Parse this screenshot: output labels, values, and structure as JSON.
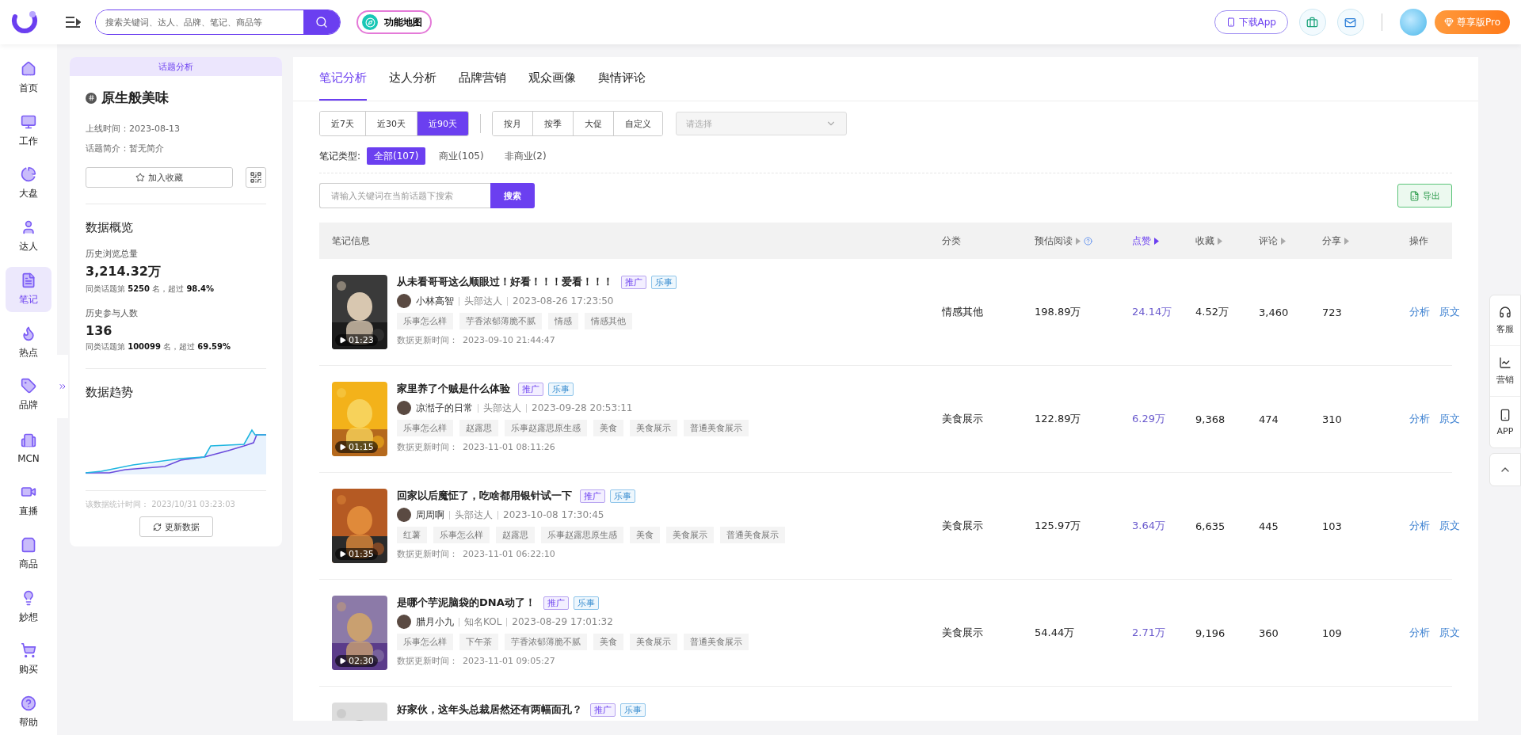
{
  "header": {
    "search_placeholder": "搜索关键词、达人、品牌、笔记、商品等",
    "feature_map": "功能地图",
    "download": "下载App",
    "vip": "尊享版Pro"
  },
  "nav": [
    {
      "label": "首页",
      "selected": false
    },
    {
      "label": "工作",
      "selected": false
    },
    {
      "label": "大盘",
      "selected": false
    },
    {
      "label": "达人",
      "selected": false
    },
    {
      "label": "笔记",
      "selected": true
    },
    {
      "label": "热点",
      "selected": false
    },
    {
      "label": "品牌",
      "selected": false
    },
    {
      "label": "MCN",
      "selected": false
    },
    {
      "label": "直播",
      "selected": false
    },
    {
      "label": "商品",
      "selected": false
    },
    {
      "label": "妙想",
      "selected": false
    },
    {
      "label": "购买",
      "selected": false
    },
    {
      "label": "帮助",
      "selected": false
    }
  ],
  "topic": {
    "banner": "话题分析",
    "title": "原生般美味",
    "online": "上线时间：2023-08-13",
    "intro": "话题简介：暂无简介",
    "favorite": "加入收藏",
    "overview_title": "数据概览",
    "metrics": [
      {
        "label": "历史浏览总量",
        "value": "3,214.32万",
        "rank": "同类话题第 **5250** 名，超过 **98.4%**"
      },
      {
        "label": "历史参与人数",
        "value": "136",
        "rank": "同类话题第 **100099** 名，超过 **69.59%**"
      }
    ],
    "trend_title": "数据趋势",
    "stat_time": "该数据统计时间：  2023/10/31 03:23:03",
    "refresh": "更新数据"
  },
  "tabs": [
    {
      "label": "笔记分析",
      "selected": true
    },
    {
      "label": "达人分析",
      "selected": false
    },
    {
      "label": "品牌营销",
      "selected": false
    },
    {
      "label": "观众画像",
      "selected": false
    },
    {
      "label": "舆情评论",
      "selected": false
    }
  ],
  "ranges": [
    {
      "label": "近7天",
      "selected": false
    },
    {
      "label": "近30天",
      "selected": false
    },
    {
      "label": "近90天",
      "selected": true
    }
  ],
  "periods": [
    "按月",
    "按季",
    "大促",
    "自定义"
  ],
  "period_select": {
    "placeholder": "请选择"
  },
  "note_types": {
    "label": "笔记类型:",
    "options": [
      {
        "label": "全部(107)",
        "selected": true
      },
      {
        "label": "商业(105)",
        "selected": false
      },
      {
        "label": "非商业(2)",
        "selected": false
      }
    ]
  },
  "keyword_search": {
    "placeholder": "请输入关键词在当前话题下搜索",
    "button": "搜索"
  },
  "export": "导出",
  "columns": [
    {
      "label": "笔记信息",
      "sortable": false,
      "active": false,
      "help": false
    },
    {
      "label": "分类",
      "sortable": false,
      "active": false,
      "help": false
    },
    {
      "label": "预估阅读",
      "sortable": true,
      "active": false,
      "help": true
    },
    {
      "label": "点赞",
      "sortable": true,
      "active": true,
      "help": false
    },
    {
      "label": "收藏",
      "sortable": true,
      "active": false,
      "help": false
    },
    {
      "label": "评论",
      "sortable": true,
      "active": false,
      "help": false
    },
    {
      "label": "分享",
      "sortable": true,
      "active": false,
      "help": false
    },
    {
      "label": "操作",
      "sortable": false,
      "active": false,
      "help": false
    }
  ],
  "rows": [
    {
      "title": "从未看哥哥这么顺眼过！好看！！！爱看！！！",
      "badges": [
        {
          "label": "推广",
          "kind": "promo"
        },
        {
          "label": "乐事",
          "kind": "brand"
        }
      ],
      "duration": "01:23",
      "author": "小林高智",
      "level": "头部达人",
      "published": "2023-08-26 17:23:50",
      "topics": [
        "乐事怎么样",
        "芋香浓郁薄脆不腻",
        "情感",
        "情感其他"
      ],
      "updated_label": "数据更新时间：",
      "updated": "2023-09-10 21:44:47",
      "category": "情感其他",
      "reads": "198.89万",
      "likes": "24.14万",
      "favorites": "4.52万",
      "comments": "3,460",
      "shares": "723",
      "actions": [
        "分析",
        "原文"
      ]
    },
    {
      "title": "家里养了个贼是什么体验",
      "badges": [
        {
          "label": "推广",
          "kind": "promo"
        },
        {
          "label": "乐事",
          "kind": "brand"
        }
      ],
      "duration": "01:15",
      "author": "凉湉子的日常",
      "level": "头部达人",
      "published": "2023-09-28 20:53:11",
      "topics": [
        "乐事怎么样",
        "赵露思",
        "乐事赵露思原生感",
        "美食",
        "美食展示",
        "普通美食展示"
      ],
      "updated_label": "数据更新时间：",
      "updated": "2023-11-01 08:11:26",
      "category": "美食展示",
      "reads": "122.89万",
      "likes": "6.29万",
      "favorites": "9,368",
      "comments": "474",
      "shares": "310",
      "actions": [
        "分析",
        "原文"
      ]
    },
    {
      "title": "回家以后魔怔了，吃啥都用银针试一下",
      "badges": [
        {
          "label": "推广",
          "kind": "promo"
        },
        {
          "label": "乐事",
          "kind": "brand"
        }
      ],
      "duration": "01:35",
      "author": "周周啊",
      "level": "头部达人",
      "published": "2023-10-08 17:30:45",
      "topics": [
        "红薯",
        "乐事怎么样",
        "赵露思",
        "乐事赵露思原生感",
        "美食",
        "美食展示",
        "普通美食展示"
      ],
      "updated_label": "数据更新时间：",
      "updated": "2023-11-01 06:22:10",
      "category": "美食展示",
      "reads": "125.97万",
      "likes": "3.64万",
      "favorites": "6,635",
      "comments": "445",
      "shares": "103",
      "actions": [
        "分析",
        "原文"
      ]
    },
    {
      "title": "是哪个芋泥脑袋的DNA动了！",
      "badges": [
        {
          "label": "推广",
          "kind": "promo"
        },
        {
          "label": "乐事",
          "kind": "brand"
        }
      ],
      "duration": "02:30",
      "author": "腊月小九",
      "level": "知名KOL",
      "published": "2023-08-29 17:01:32",
      "topics": [
        "乐事怎么样",
        "下午茶",
        "芋香浓郁薄脆不腻",
        "美食",
        "美食展示",
        "普通美食展示"
      ],
      "updated_label": "数据更新时间：",
      "updated": "2023-11-01 09:05:27",
      "category": "美食展示",
      "reads": "54.44万",
      "likes": "2.71万",
      "favorites": "9,196",
      "comments": "360",
      "shares": "109",
      "actions": [
        "分析",
        "原文"
      ]
    },
    {
      "title": "好家伙，这年头总裁居然还有两幅面孔？",
      "badges": [
        {
          "label": "推广",
          "kind": "promo"
        },
        {
          "label": "乐事",
          "kind": "brand"
        }
      ]
    }
  ],
  "side_tools": [
    {
      "label": "客服",
      "kind": "service"
    },
    {
      "label": "营销",
      "kind": "marketing"
    },
    {
      "label": "APP",
      "kind": "app"
    }
  ]
}
